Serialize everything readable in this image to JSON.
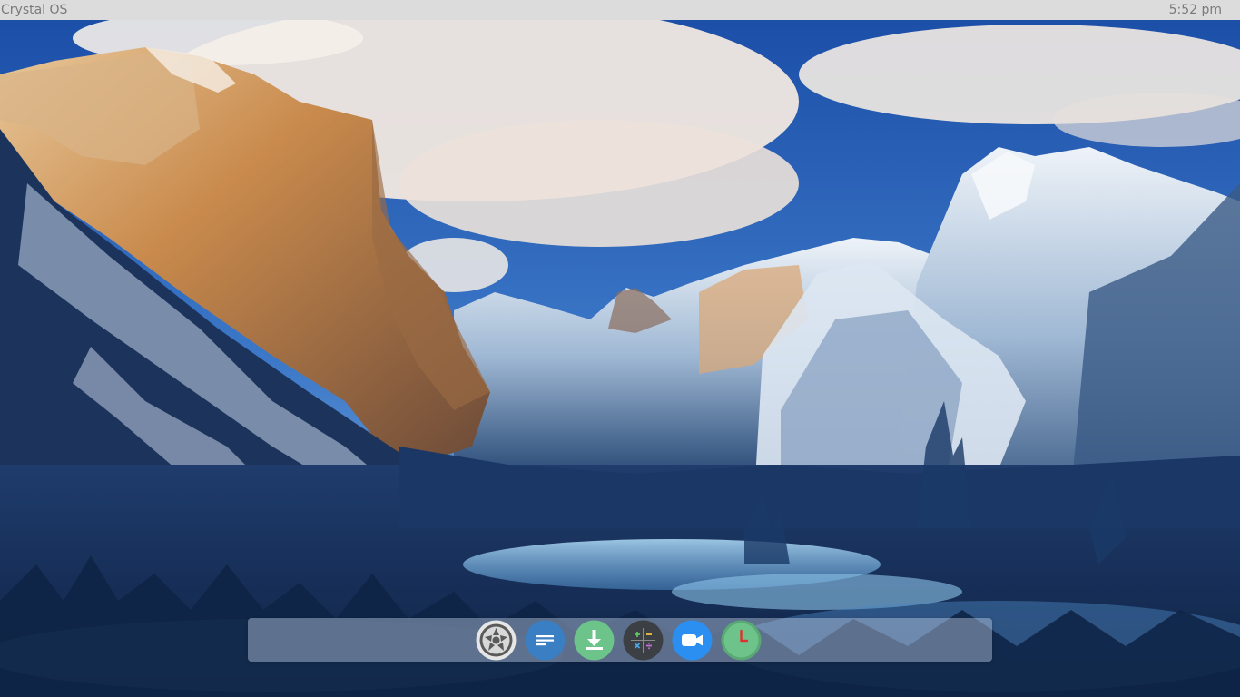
{
  "topbar": {
    "os_name": "Crystal OS",
    "time": "5:52 pm"
  },
  "wallpaper": {
    "description_icon": "mountain-landscape-wallpaper"
  },
  "dock": {
    "apps": [
      {
        "icon": "settings-wheel-icon",
        "color": "#d0d0d0"
      },
      {
        "icon": "menu-lines-icon",
        "color": "#3a7fc4"
      },
      {
        "icon": "download-icon",
        "color": "#6cc48a"
      },
      {
        "icon": "calculator-icon",
        "color": "#3c4044"
      },
      {
        "icon": "video-camera-icon",
        "color": "#2a8ff0"
      },
      {
        "icon": "clock-icon",
        "color": "#6ec38a"
      }
    ]
  }
}
